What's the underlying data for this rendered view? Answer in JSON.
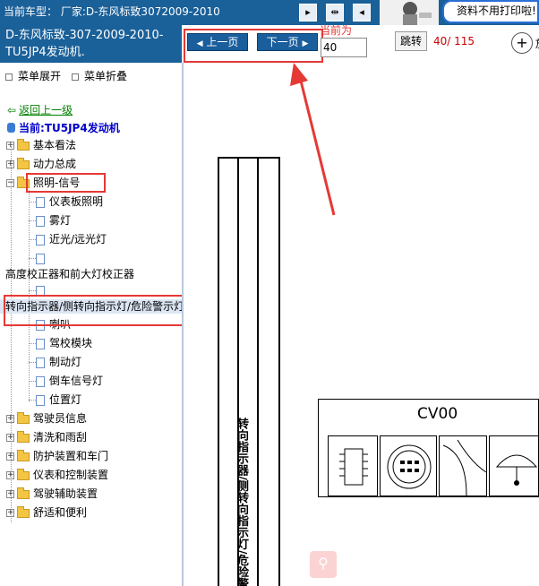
{
  "topbar": {
    "current_vehicle": "当前车型：  厂家:D-东风标致3072009-2010",
    "note": "资料不用打印啦!"
  },
  "sidebar": {
    "vehicle_title": "D-东风标致-307-2009-2010- TU5JP4发动机.",
    "expand_all": "菜单展开",
    "collapse_all": "菜单折叠",
    "back_link": "返回上一级",
    "current_node": "当前:TU5JP4发动机",
    "tree": {
      "basics": "基本看法",
      "powertrain": "动力总成",
      "lighting": "照明-信号",
      "dashboard_light": "仪表板照明",
      "fog_light": "雾灯",
      "headlight": "近光/远光灯",
      "headlight_leveler": "高度校正器和前大灯校正器",
      "turn_signal": "转向指示器/侧转向指示灯/危险警示灯",
      "horn": "喇叭",
      "driving_school": "驾校模块",
      "brake_light": "制动灯",
      "reverse_light": "倒车信号灯",
      "position_light": "位置灯",
      "driver_info": "驾驶员信息",
      "wash_wipe": "清洗和雨刮",
      "protection_doors": "防护装置和车门",
      "instruments_controls": "仪表和控制装置",
      "driving_assist": "驾驶辅助装置",
      "comfort": "舒适和便利"
    }
  },
  "toolbar": {
    "prev_page": "上一页",
    "next_page": "下一页",
    "current_label": "当前为",
    "page_input": "40",
    "jump_button": "跳转",
    "page_indicator": "40/ 115",
    "zoom_text": "放"
  },
  "content": {
    "diagram_vertical_text": "转向指示器/侧转向指示灯/危险警告灯",
    "connector_label": "CV00"
  },
  "colors": {
    "header_blue": "#1a6099",
    "annotation_red": "#e53935",
    "page_indicator_red": "#cc0000"
  }
}
